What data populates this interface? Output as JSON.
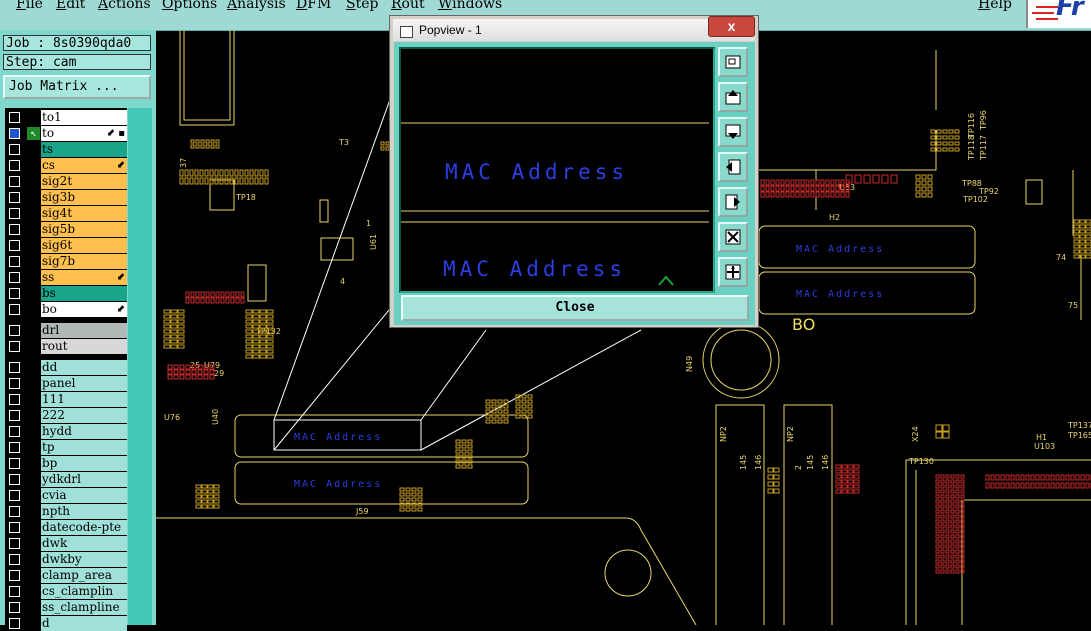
{
  "menubar": {
    "items": [
      "File",
      "Edit",
      "Actions",
      "Options",
      "Analysis",
      "DFM",
      "Step",
      "Rout",
      "Windows"
    ],
    "help": "Help",
    "logo_text": "Fr"
  },
  "job": {
    "label": "Job : 8s0390qda0",
    "step": "Step: cam",
    "matrix_button": "Job Matrix ..."
  },
  "layers": [
    {
      "name": "to1",
      "color": "#ffffff"
    },
    {
      "name": "to",
      "color": "#ffffff",
      "mark": "⬋ ▪",
      "active": true
    },
    {
      "name": "ts",
      "color": "#1aa58a"
    },
    {
      "name": "cs",
      "color": "#ffc04d",
      "mark": "⬋"
    },
    {
      "name": "sig2t",
      "color": "#ffc04d"
    },
    {
      "name": "sig3b",
      "color": "#ffc04d"
    },
    {
      "name": "sig4t",
      "color": "#ffc04d"
    },
    {
      "name": "sig5b",
      "color": "#ffc04d"
    },
    {
      "name": "sig6t",
      "color": "#ffc04d"
    },
    {
      "name": "sig7b",
      "color": "#ffc04d"
    },
    {
      "name": "ss",
      "color": "#ffc04d",
      "mark": "⬋"
    },
    {
      "name": "bs",
      "color": "#1aa58a"
    },
    {
      "name": "bo",
      "color": "#ffffff",
      "mark": "⬋"
    },
    {
      "name": "drl",
      "color": "#b0b8b8",
      "gap": true
    },
    {
      "name": "rout",
      "color": "#d8d8d8"
    },
    {
      "name": "dd",
      "color": "#9fe0d8",
      "gap": true
    },
    {
      "name": "panel",
      "color": "#9fe0d8"
    },
    {
      "name": "111",
      "color": "#9fe0d8"
    },
    {
      "name": "222",
      "color": "#9fe0d8"
    },
    {
      "name": "hydd",
      "color": "#9fe0d8"
    },
    {
      "name": "tp",
      "color": "#9fe0d8"
    },
    {
      "name": "bp",
      "color": "#9fe0d8"
    },
    {
      "name": "ydkdrl",
      "color": "#9fe0d8"
    },
    {
      "name": "cvia",
      "color": "#9fe0d8"
    },
    {
      "name": "npth",
      "color": "#9fe0d8"
    },
    {
      "name": "datecode-pte",
      "color": "#9fe0d8"
    },
    {
      "name": "dwk",
      "color": "#9fe0d8"
    },
    {
      "name": "dwkby",
      "color": "#9fe0d8"
    },
    {
      "name": "clamp_area",
      "color": "#9fe0d8"
    },
    {
      "name": "cs_clamplin",
      "color": "#9fe0d8"
    },
    {
      "name": "ss_clampline",
      "color": "#9fe0d8"
    },
    {
      "name": "d",
      "color": "#9fe0d8"
    }
  ],
  "board": {
    "labels": [
      "TP18",
      "T3",
      "U61",
      "TP132",
      "U76",
      "U40",
      "U79",
      "J59",
      "H2",
      "U33",
      "TP88",
      "TP92",
      "TP102",
      "TP118",
      "TP116",
      "TP117",
      "TP96",
      "BO",
      "N49",
      "NP2",
      "145",
      "146",
      "X24",
      "H1",
      "U103",
      "TP130",
      "TP137",
      "TP165",
      "74",
      "75",
      "37",
      "25",
      "29",
      "4",
      "1",
      "2"
    ],
    "mac_text": "MAC Address"
  },
  "popview": {
    "title": "Popview - 1",
    "close_x": "x",
    "mac_top": "MAC Address",
    "mac_bottom": "MAC Address",
    "close_button": "Close",
    "tools": [
      "zoom-window-icon",
      "pan-up-icon",
      "pan-down-icon",
      "pan-left-icon",
      "pan-right-icon",
      "zoom-fit-icon",
      "zoom-home-icon"
    ]
  },
  "colors": {
    "trace": "#e8d56a",
    "silk": "#ffff00",
    "mac": "#2b3ee0",
    "pad": "#c8a020",
    "pad_red": "#c82a2a",
    "outline": "#d0c890"
  }
}
